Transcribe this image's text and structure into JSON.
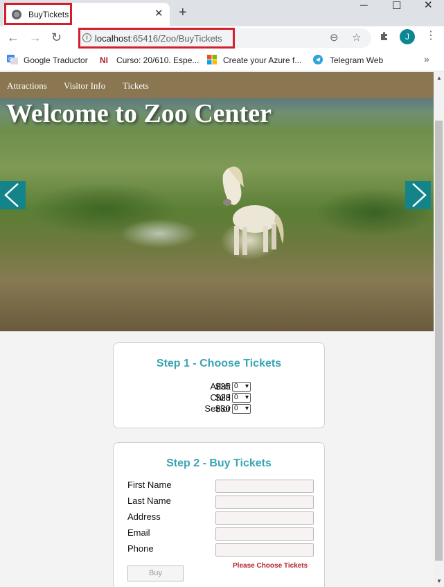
{
  "browser": {
    "tab_title": "BuyTickets",
    "url_host": "localhost",
    "url_rest": ":65416/Zoo/BuyTickets",
    "avatar_letter": "J",
    "bookmarks": [
      {
        "label": "Google Traductor",
        "icon": "translate-icon"
      },
      {
        "label": "Curso: 20/610. Espe...",
        "icon": "ni-icon"
      },
      {
        "label": "Create your Azure f...",
        "icon": "microsoft-icon"
      },
      {
        "label": "Telegram Web",
        "icon": "telegram-icon"
      }
    ]
  },
  "site": {
    "nav": [
      "Attractions",
      "Visitor Info",
      "Tickets"
    ],
    "hero_title": "Welcome to Zoo Center"
  },
  "step1": {
    "title": "Step 1 - Choose Tickets",
    "tickets": [
      {
        "label": "Adult",
        "price": "$35",
        "qty": "0"
      },
      {
        "label": "Child",
        "price": "$23",
        "qty": "0"
      },
      {
        "label": "Senior",
        "price": "$30",
        "qty": "0"
      }
    ]
  },
  "step2": {
    "title": "Step 2 - Buy Tickets",
    "fields": [
      "First Name",
      "Last Name",
      "Address",
      "Email",
      "Phone"
    ],
    "warning": "Please Choose Tickets",
    "buy_label": "Buy"
  },
  "colors": {
    "nav_bg": "#8a7651",
    "accent": "#38a5b4",
    "arrow_bg": "#138489",
    "warning": "#b5232d"
  }
}
